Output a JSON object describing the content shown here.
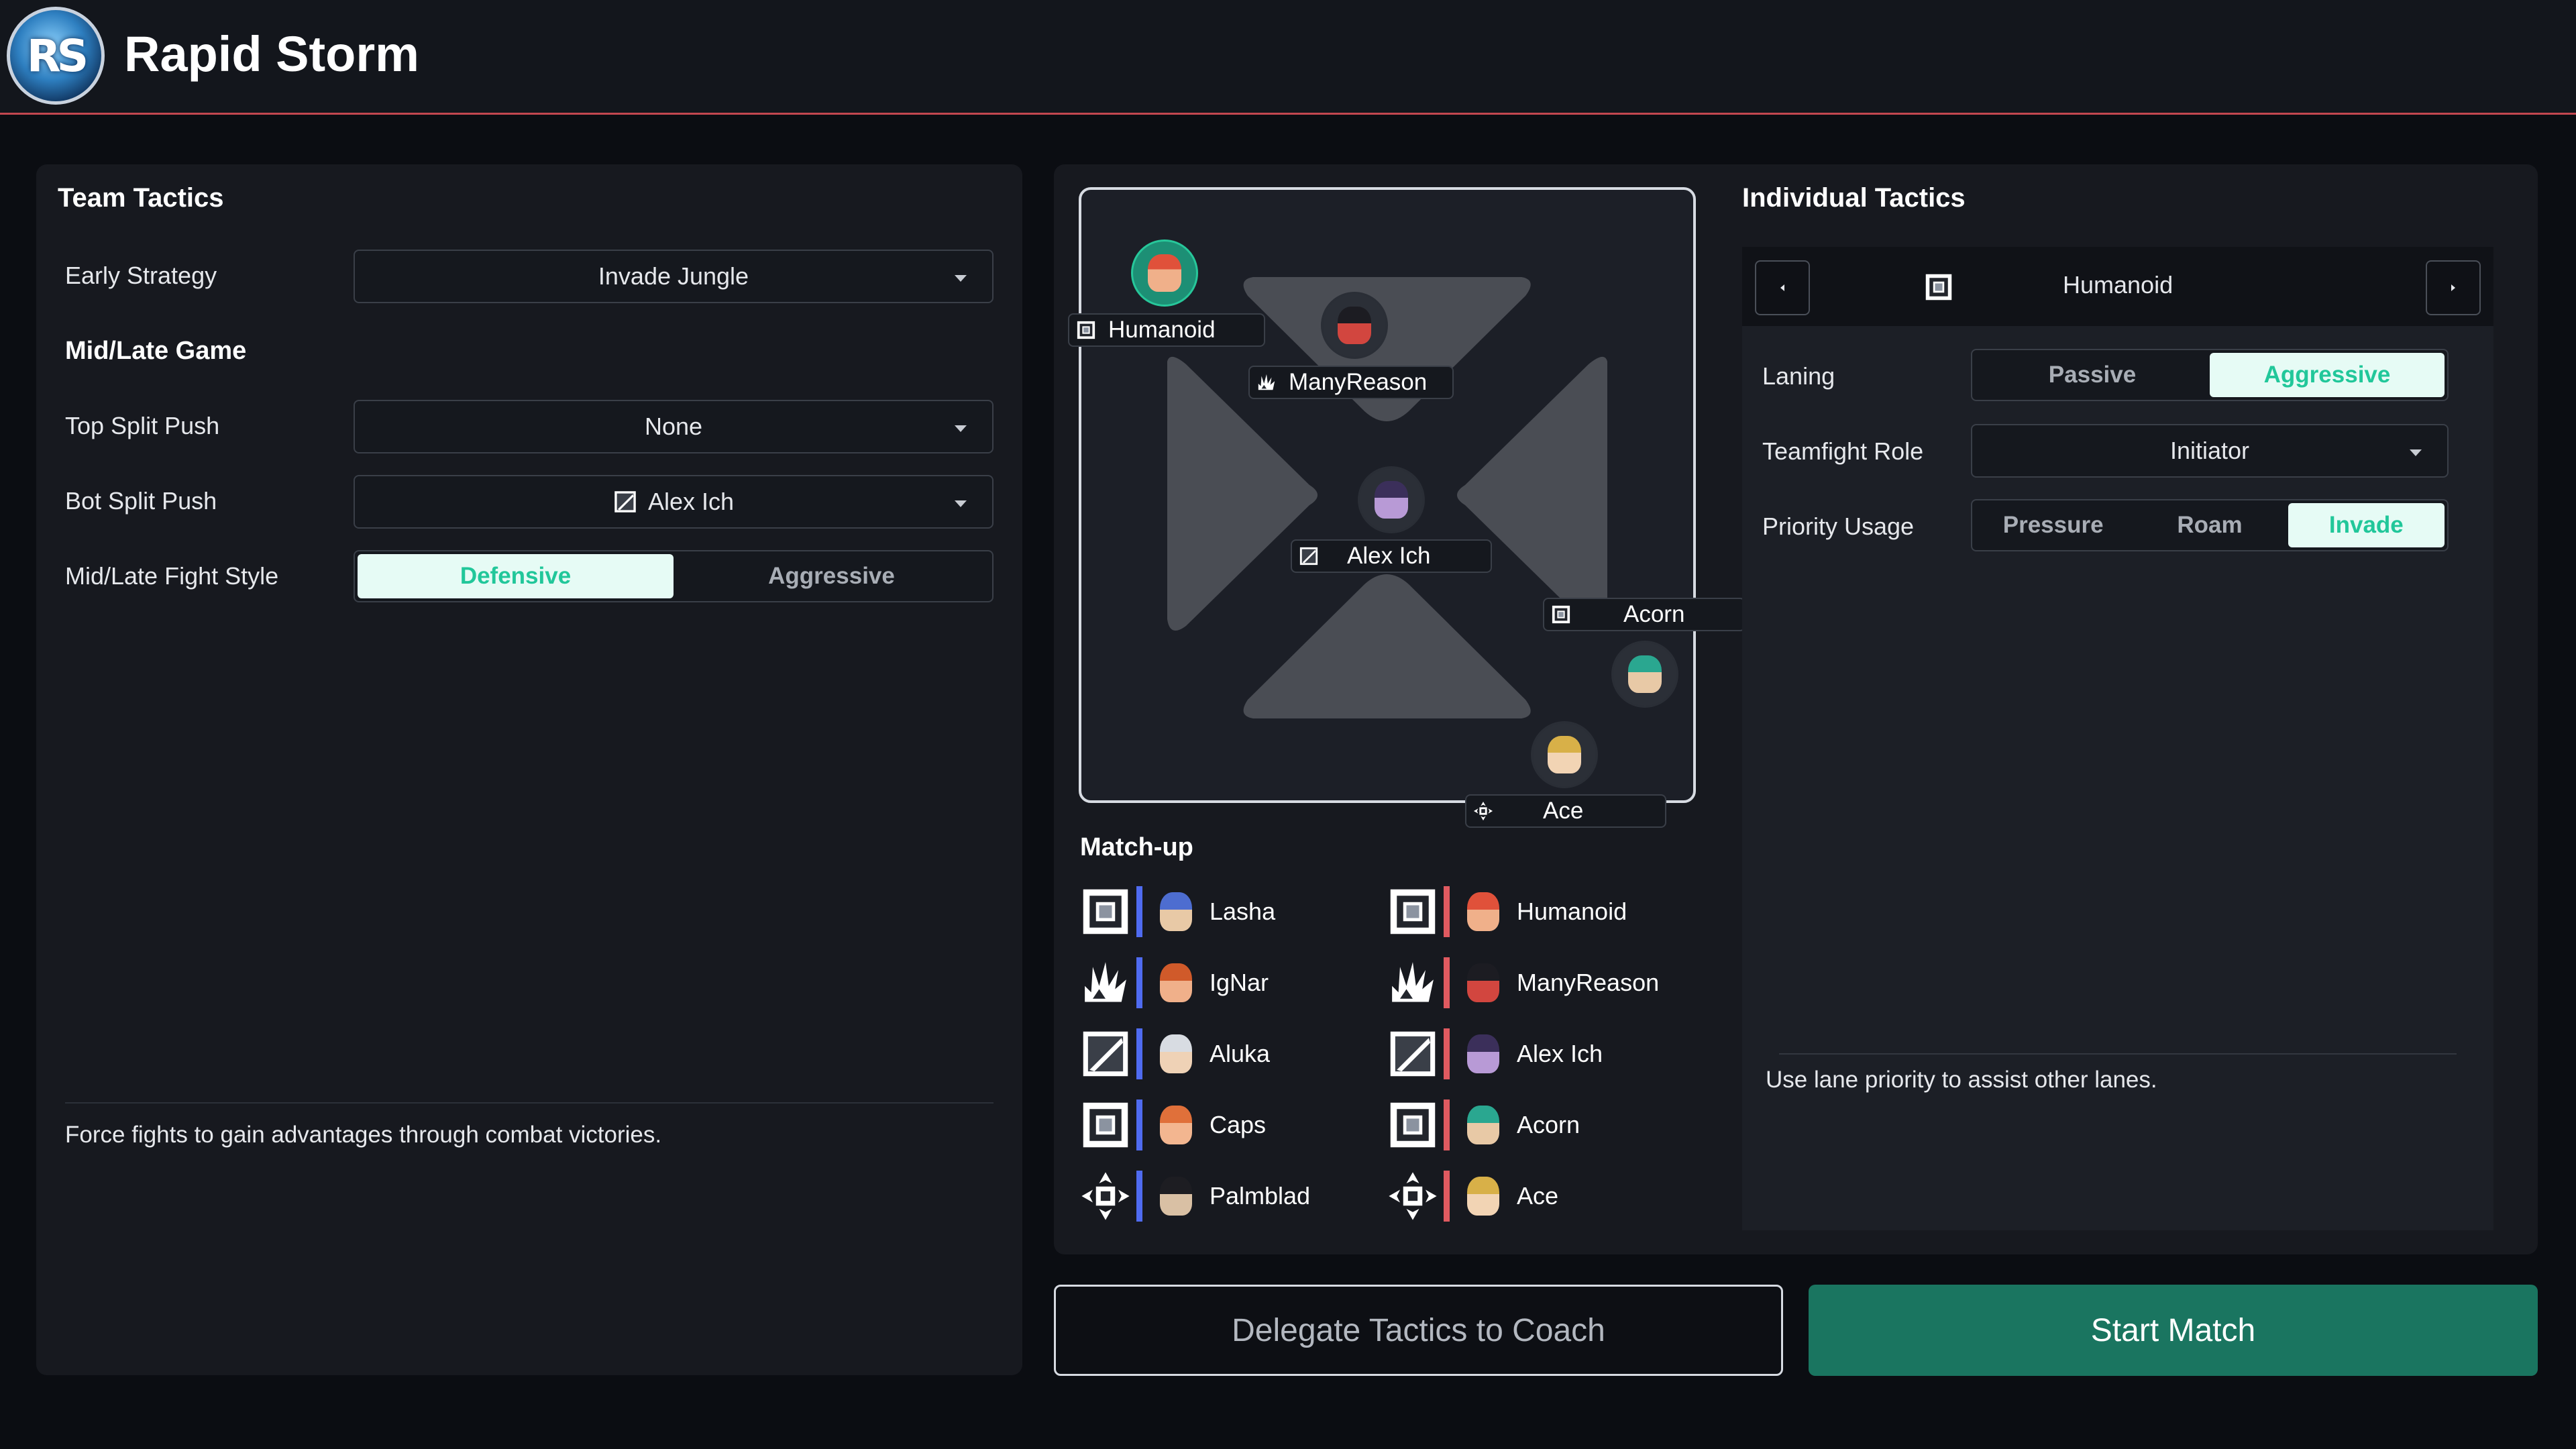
{
  "app": {
    "title": "Rapid Storm",
    "logo_text": "RS"
  },
  "team_tactics": {
    "title": "Team Tactics",
    "early_strategy": {
      "label": "Early Strategy",
      "value": "Invade Jungle"
    },
    "mid_late_heading": "Mid/Late Game",
    "top_split_push": {
      "label": "Top Split Push",
      "value": "None"
    },
    "bot_split_push": {
      "label": "Bot Split Push",
      "value": "Alex Ich",
      "icon": "blade-icon"
    },
    "fight_style": {
      "label": "Mid/Late Fight Style",
      "options": [
        "Defensive",
        "Aggressive"
      ],
      "selected": "Defensive"
    },
    "description": "Force fights to gain advantages through combat victories."
  },
  "map": {
    "players": [
      {
        "name": "Humanoid",
        "icon": "square-frame-icon",
        "team": "mine"
      },
      {
        "name": "ManyReason",
        "icon": "claw-icon",
        "team": "mine"
      },
      {
        "name": "Alex Ich",
        "icon": "blade-icon",
        "team": "mine"
      },
      {
        "name": "Acorn",
        "icon": "square-frame-icon",
        "team": "mine"
      },
      {
        "name": "Ace",
        "icon": "crosshair-icon",
        "team": "mine"
      }
    ]
  },
  "matchup": {
    "title": "Match-up",
    "rows": [
      {
        "role_icon": "square-frame-icon",
        "blue": "Lasha",
        "red": "Humanoid"
      },
      {
        "role_icon": "claw-icon",
        "blue": "IgNar",
        "red": "ManyReason"
      },
      {
        "role_icon": "blade-icon",
        "blue": "Aluka",
        "red": "Alex Ich"
      },
      {
        "role_icon": "square-frame-icon",
        "blue": "Caps",
        "red": "Acorn"
      },
      {
        "role_icon": "crosshair-icon",
        "blue": "Palmblad",
        "red": "Ace"
      }
    ]
  },
  "individual_tactics": {
    "title": "Individual Tactics",
    "player": "Humanoid",
    "laning": {
      "label": "Laning",
      "options": [
        "Passive",
        "Aggressive"
      ],
      "selected": "Aggressive"
    },
    "teamfight_role": {
      "label": "Teamfight Role",
      "value": "Initiator"
    },
    "priority_usage": {
      "label": "Priority Usage",
      "options": [
        "Pressure",
        "Roam",
        "Invade"
      ],
      "selected": "Invade"
    },
    "description": "Use lane priority to assist other lanes."
  },
  "buttons": {
    "delegate": "Delegate Tactics to Coach",
    "start": "Start Match"
  },
  "colors": {
    "accent": "#21c79a",
    "start_button": "#1a7560",
    "header_rule": "#c2474f",
    "blue_side": "#4f6bf0",
    "red_side": "#e05a60"
  }
}
